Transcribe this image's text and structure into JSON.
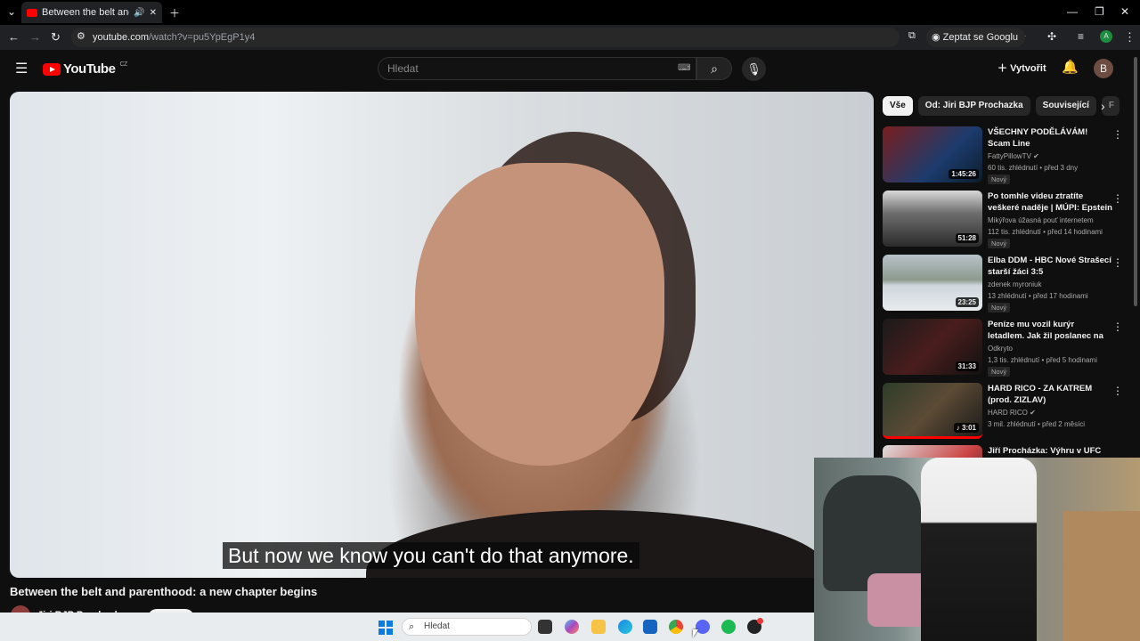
{
  "browser": {
    "tab_title": "Between the belt and paren",
    "url_host": "youtube.com",
    "url_path": "/watch?v=pu5YpEgP1y4",
    "ask_google": "Zeptat se Googlu",
    "profile_initial": "A"
  },
  "header": {
    "logo_text": "YouTube",
    "logo_region": "CZ",
    "search_placeholder": "Hledat",
    "create_label": "Vytvořit",
    "avatar_initial": "B"
  },
  "player": {
    "subtitle": "But now we know you can't do that anymore."
  },
  "video": {
    "title": "Between the belt and parenthood: a new chapter begins",
    "channel": "Jiri BJP Prochazka"
  },
  "sidebar": {
    "chips": [
      "Vše",
      "Od: Jiri BJP Prochazka",
      "Související",
      "F"
    ],
    "items": [
      {
        "title": "VŠECHNY PODĚLÁVÁM! Scam Line",
        "channel": "FattyPillowTV ✔",
        "meta": "60 tis. zhlédnutí • před 3 dny",
        "badge": "Nový",
        "duration": "1:45:26"
      },
      {
        "title": "Po tomhle videu ztratíte veškeré naděje | MÚPI: Epstein files",
        "channel": "Mikýřova úžasná pouť internetem",
        "meta": "112 tis. zhlédnutí • před 14 hodinami",
        "badge": "Nový",
        "duration": "51:28"
      },
      {
        "title": "Elba DDM - HBC Nové Strašecí starší žáci 3:5",
        "channel": "zdenek myroniuk",
        "meta": "13 zhlédnutí • před 17 hodinami",
        "badge": "Nový",
        "duration": "23:25"
      },
      {
        "title": "Peníze mu vozil kurýr letadlem. Jak žil poslanec na útěku? A c...",
        "channel": "Odkryto",
        "meta": "1,3 tis. zhlédnutí • před 5 hodinami",
        "badge": "Nový",
        "duration": "31:33"
      },
      {
        "title": "HARD RICO - ZA KATREM (prod. ZIZLAV)",
        "channel": "HARD RICO ✔",
        "meta": "3 mil. zhlédnutí • před 2 měsíci",
        "badge": "",
        "duration": "♪ 3:01"
      },
      {
        "title": "Jiří Procházka: Výhru v UFC",
        "channel": "",
        "meta": "",
        "badge": "",
        "duration": ""
      }
    ]
  },
  "taskbar": {
    "search_placeholder": "Hledat"
  },
  "colors": {
    "background": "#0f0f0f",
    "youtube_red": "#ff0000",
    "chip_active": "#f1f1f1",
    "taskbar": "#e9ecef"
  }
}
